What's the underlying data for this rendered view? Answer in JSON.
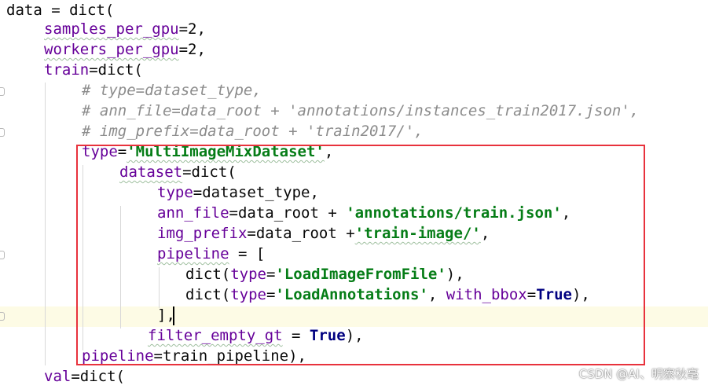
{
  "code": {
    "l1": {
      "a": "data = dict("
    },
    "l2": {
      "a": "samples_per_gpu",
      "b": "=2,"
    },
    "l3": {
      "a": "workers_per_gpu",
      "b": "=2,"
    },
    "l4": {
      "a": "train",
      "b": "=dict("
    },
    "l5": {
      "a": "# type=dataset_type,"
    },
    "l6": {
      "a": "# ann_file=data_root + 'annotations/instances_train2017.json',"
    },
    "l7": {
      "a": "# img_prefix=data_root + 'train2017/',"
    },
    "l8": {
      "a": "type",
      "b": "=",
      "c": "'MultiImageMixDataset'",
      "d": ","
    },
    "l9": {
      "a": "dataset",
      "b": "=dict("
    },
    "l10": {
      "a": "type",
      "b": "=dataset_type,"
    },
    "l11": {
      "a": "ann_file",
      "b": "=data_root + ",
      "c": "'annotations/train.json'",
      "d": ","
    },
    "l12": {
      "a": "img_prefix",
      "b": "=data_root +",
      "c": "'train-image/'",
      "d": ","
    },
    "l13": {
      "a": "pipeline",
      "b": " = ["
    },
    "l14": {
      "a": "dict(",
      "b": "type",
      "c": "=",
      "d": "'LoadImageFromFile'",
      "e": "),"
    },
    "l15": {
      "a": "dict(",
      "b": "type",
      "c": "=",
      "d": "'LoadAnnotations'",
      "e": ", ",
      "f": "with_bbox",
      "g": "=",
      "h": "True",
      "i": "),"
    },
    "l16": {
      "a": "],"
    },
    "l17": {
      "a": "filter_empty_gt",
      "b": " = ",
      "c": "True",
      "d": "),"
    },
    "l18": {
      "a": "pipeline",
      "b": "=train_pipeline),"
    },
    "l19": {
      "a": "val",
      "b": "=dict("
    }
  },
  "watermark": "CSDN @AI、明察秋毫",
  "colors": {
    "param": "#660099",
    "string": "#067d17",
    "keyword": "#000080",
    "comment": "#8c8c8c",
    "highlight_box": "#e8323c",
    "current_line": "#fdfbe5"
  }
}
